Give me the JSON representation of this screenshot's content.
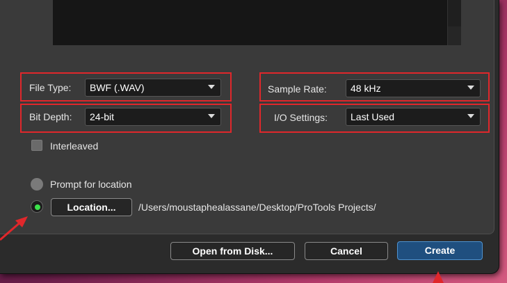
{
  "settings": {
    "file_type": {
      "label": "File Type:",
      "value": "BWF (.WAV)"
    },
    "sample_rate": {
      "label": "Sample Rate:",
      "value": "48 kHz"
    },
    "bit_depth": {
      "label": "Bit Depth:",
      "value": "24-bit"
    },
    "io_settings": {
      "label": "I/O Settings:",
      "value": "Last Used"
    },
    "interleaved": {
      "label": "Interleaved",
      "checked": false
    }
  },
  "location": {
    "prompt_label": "Prompt for location",
    "prompt_selected": false,
    "location_button_label": "Location...",
    "location_selected": true,
    "path": "/Users/moustaphealassane/Desktop/ProTools Projects/"
  },
  "footer": {
    "open_from_disk_label": "Open from Disk...",
    "cancel_label": "Cancel",
    "create_label": "Create"
  },
  "colors": {
    "highlight": "#e0272b",
    "radio_selected": "#3be24a",
    "primary_button": "#1f4f7f"
  }
}
